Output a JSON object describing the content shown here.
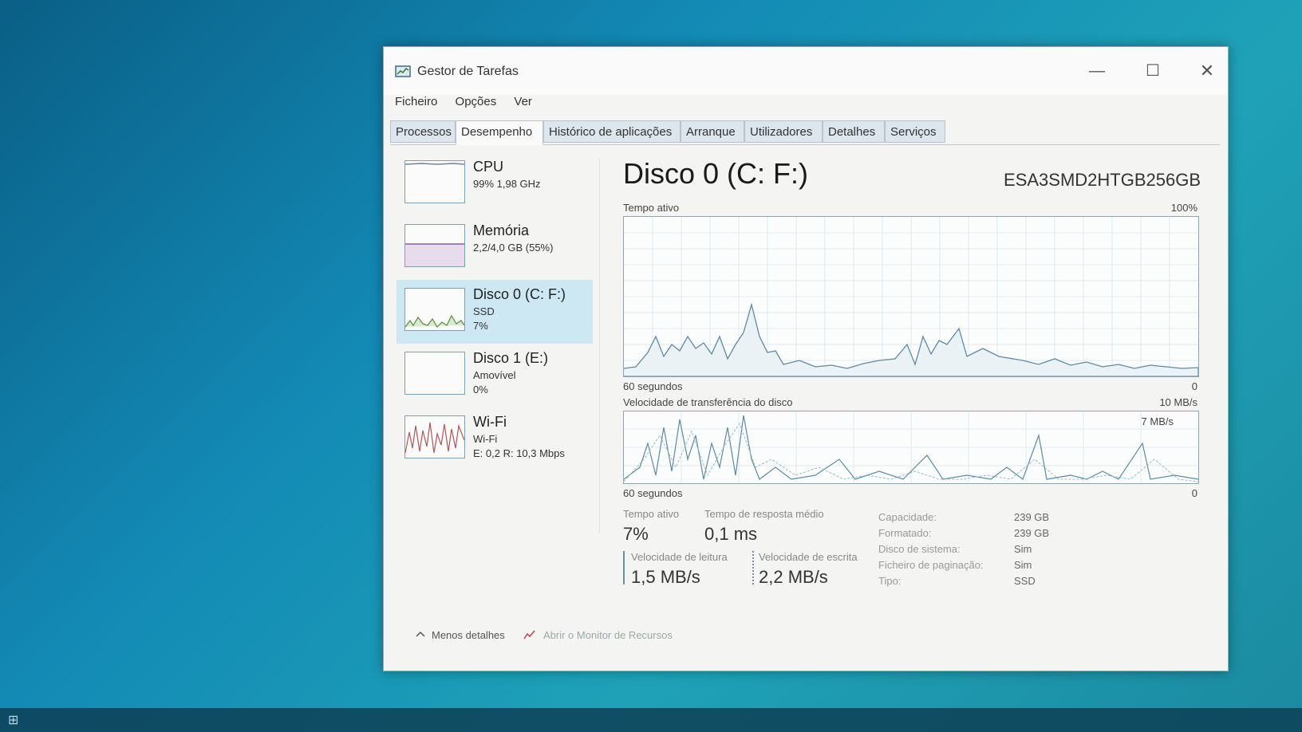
{
  "window": {
    "title": "Gestor de Tarefas",
    "controls": {
      "minimize": "—",
      "maximize": "☐",
      "close": "✕"
    }
  },
  "menu": [
    "Ficheiro",
    "Opções",
    "Ver"
  ],
  "tabs": [
    {
      "label": "Processos",
      "active": false
    },
    {
      "label": "Desempenho",
      "active": true
    },
    {
      "label": "Histórico de aplicações",
      "active": false
    },
    {
      "label": "Arranque",
      "active": false
    },
    {
      "label": "Utilizadores",
      "active": false
    },
    {
      "label": "Detalhes",
      "active": false
    },
    {
      "label": "Serviços",
      "active": false
    }
  ],
  "sidebar": [
    {
      "name": "CPU",
      "line1": "99% 1,98 GHz",
      "line2": ""
    },
    {
      "name": "Memória",
      "line1": "2,2/4,0 GB (55%)",
      "line2": ""
    },
    {
      "name": "Disco 0 (C: F:)",
      "line1": "SSD",
      "line2": "7%",
      "active": true
    },
    {
      "name": "Disco 1 (E:)",
      "line1": "Amovível",
      "line2": "0%"
    },
    {
      "name": "Wi-Fi",
      "line1": "Wi-Fi",
      "line2": "E: 0,2 R: 10,3 Mbps"
    }
  ],
  "main": {
    "title": "Disco 0 (C: F:)",
    "model": "ESA3SMD2HTGB256GB",
    "active_time_label": "Tempo ativo",
    "active_time_max": "100%",
    "active_time_min": "0",
    "duration_label": "60 segundos",
    "transfer_label": "Velocidade de transferência do disco",
    "transfer_max": "10 MB/s",
    "transfer_mid": "7 MB/s",
    "transfer_min": "0",
    "duration_label2": "60 segundos",
    "stats": {
      "active_time_label": "Tempo ativo",
      "active_time": "7%",
      "response_label": "Tempo de resposta médio",
      "response": "0,1 ms",
      "read_label": "Velocidade de leitura",
      "read": "1,5 MB/s",
      "write_label": "Velocidade de escrita",
      "write": "2,2 MB/s"
    },
    "properties": [
      {
        "label": "Capacidade:",
        "value": "239 GB"
      },
      {
        "label": "Formatado:",
        "value": "239 GB"
      },
      {
        "label": "Disco de sistema:",
        "value": "Sim"
      },
      {
        "label": "Ficheiro de paginação:",
        "value": "Sim"
      },
      {
        "label": "Tipo:",
        "value": "SSD"
      }
    ]
  },
  "footer": {
    "less_details": "Menos detalhes",
    "open_monitor": "Abrir o Monitor de Recursos"
  },
  "colors": {
    "accent": "#cde8f3",
    "graph_line": "#5f8aa0",
    "wifi_line": "#b25656"
  }
}
